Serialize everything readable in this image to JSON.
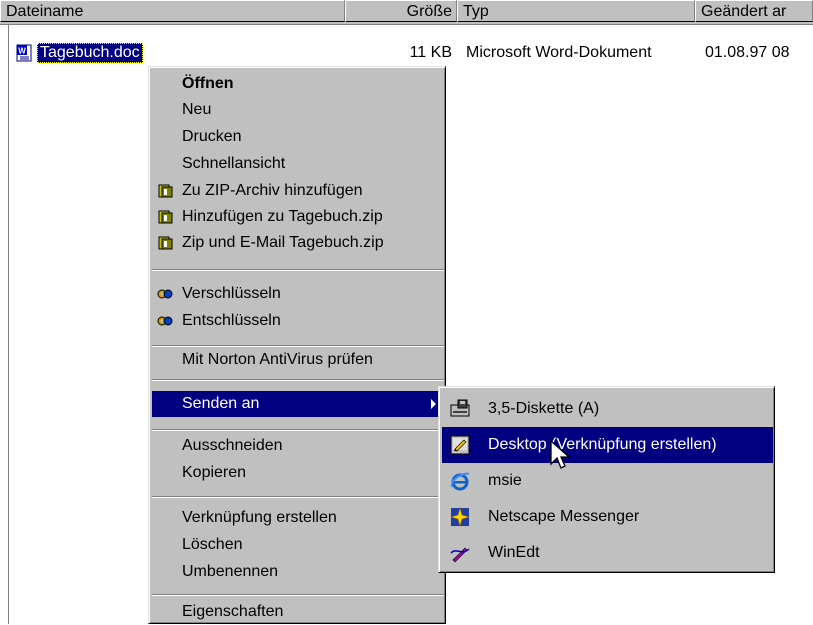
{
  "header": {
    "columns": [
      "Dateiname",
      "Größe",
      "Typ",
      "Geändert ar"
    ]
  },
  "file": {
    "name": "Tagebuch.doc",
    "size": "11 KB",
    "type": "Microsoft Word-Dokument",
    "modified": "01.08.97 08",
    "icon": "word-doc-icon"
  },
  "context_menu": {
    "open": "Öffnen",
    "new": "Neu",
    "print": "Drucken",
    "quickview": "Schnellansicht",
    "zip_add": "Zu ZIP-Archiv hinzufügen",
    "zip_add_named": "Hinzufügen zu Tagebuch.zip",
    "zip_email": "Zip und E-Mail Tagebuch.zip",
    "encrypt": "Verschlüsseln",
    "decrypt": "Entschlüsseln",
    "norton": "Mit Norton AntiVirus prüfen",
    "send_to": "Senden an",
    "cut": "Ausschneiden",
    "copy": "Kopieren",
    "shortcut": "Verknüpfung erstellen",
    "delete": "Löschen",
    "rename": "Umbenennen",
    "properties": "Eigenschaften"
  },
  "send_to_menu": {
    "floppy": "3,5-Diskette (A)",
    "desktop": "Desktop (Verknüpfung erstellen)",
    "msie": "msie",
    "netscape": "Netscape Messenger",
    "winedt": "WinEdt"
  },
  "colors": {
    "selection": "#000080",
    "face": "#c0c0c0",
    "text": "#000000",
    "selected_text": "#ffffff"
  }
}
